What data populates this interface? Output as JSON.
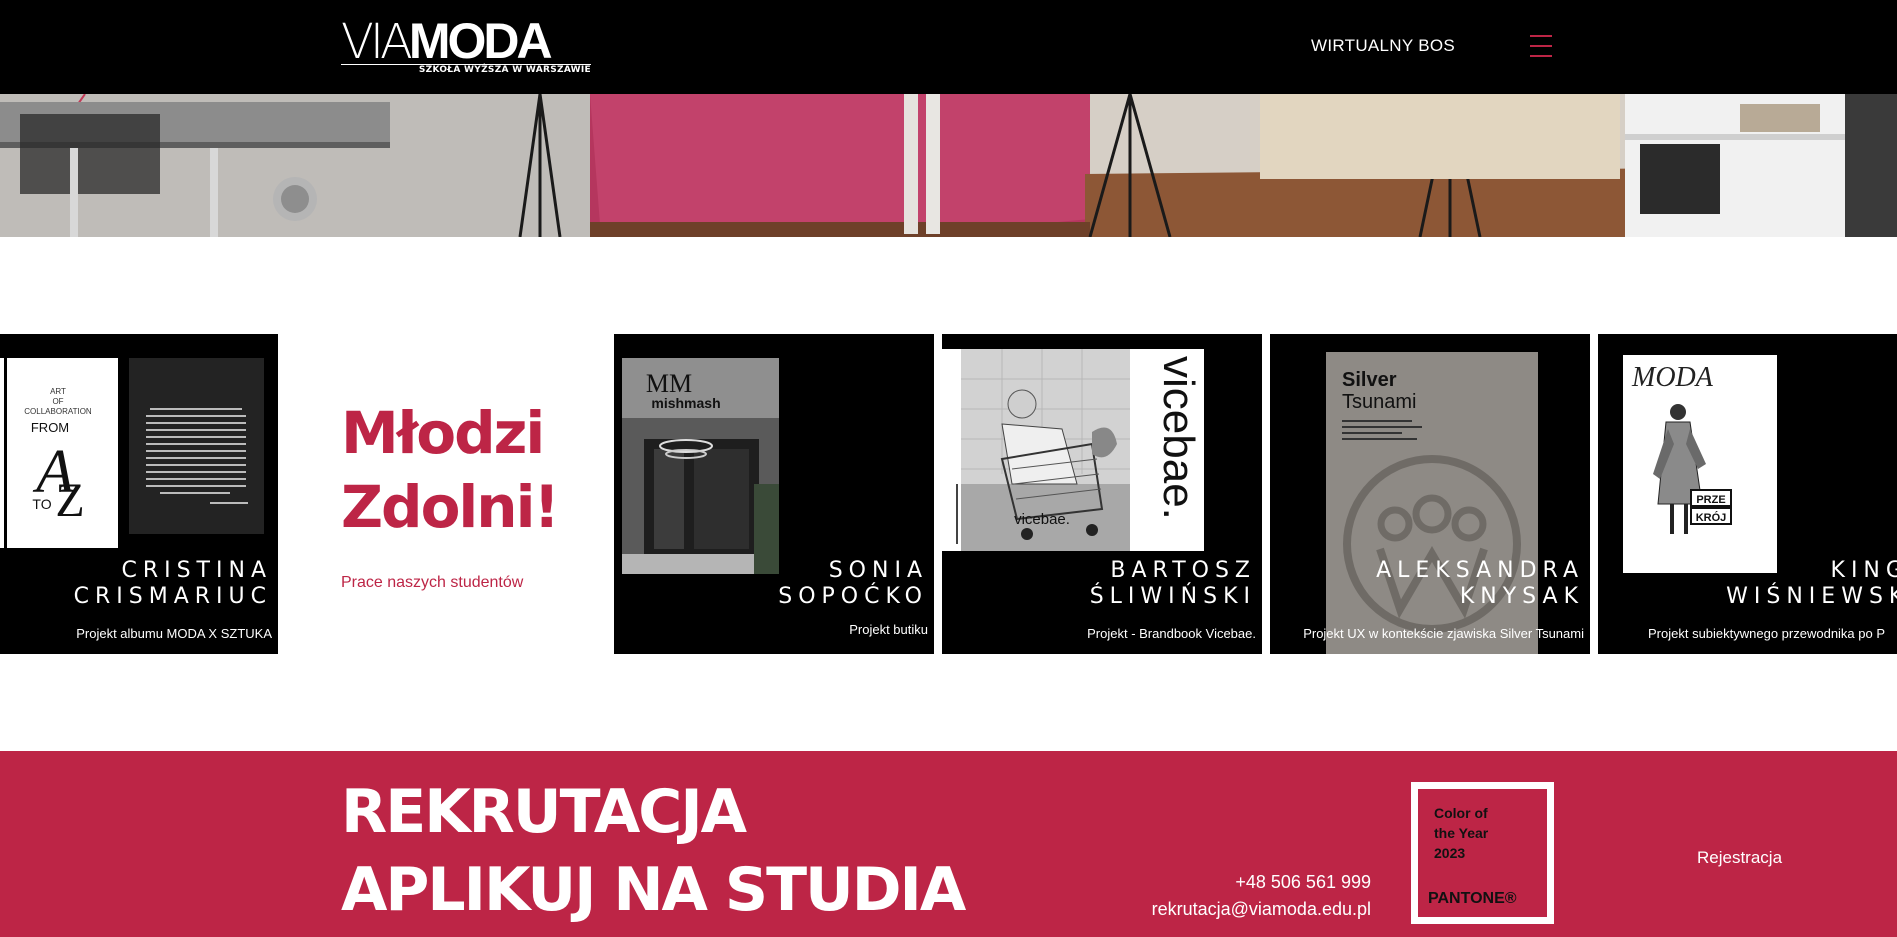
{
  "header": {
    "logo_via": "VIA",
    "logo_moda": "MODA",
    "logo_tagline": "SZKOŁA WYŻSZA W WARSZAWIE",
    "nav_link": "WIRTUALNY BOS",
    "menu_icon": "hamburger-menu-icon",
    "accent_color": "#bd2546"
  },
  "intro": {
    "title_line1": "Młodzi",
    "title_line2": "Zdolni!",
    "subtitle": "Prace naszych studentów"
  },
  "cards": [
    {
      "name_line1": "CRISTINA",
      "name_line2": "CRISMARIUC",
      "description": "Projekt albumu MODA X SZTUKA",
      "art_text": [
        "ART",
        "OF",
        "COLLABORATION",
        "FROM",
        "A",
        "TO",
        "Z"
      ]
    },
    {
      "name_line1": "SONIA",
      "name_line2": "SOPOĆKO",
      "description": "Projekt butiku",
      "art_text": [
        "MM",
        "mishmash"
      ]
    },
    {
      "name_line1": "BARTOSZ",
      "name_line2": "ŚLIWIŃSKI",
      "description": "Projekt - Brandbook Vicebae.",
      "art_text": [
        "vicebae.",
        "vicebae."
      ]
    },
    {
      "name_line1": "ALEKSANDRA",
      "name_line2": "KNYSAK",
      "description": "Projekt UX w kontekście zjawiska Silver Tsunami",
      "art_text": [
        "Silver",
        "Tsunami"
      ]
    },
    {
      "name_line1": "KINGA",
      "name_line2": "WIŚNIEWSKA",
      "description": "Projekt subiektywnego przewodnika po P",
      "art_text": [
        "MODA",
        "PRZE",
        "KRÓJ"
      ]
    }
  ],
  "recruitment": {
    "title_line1": "REKRUTACJA",
    "title_line2": "APLIKUJ NA STUDIA",
    "phone": "+48 506 561 999",
    "email": "rekrutacja@viamoda.edu.pl",
    "pantone_line1": "Color of",
    "pantone_line2": "the Year",
    "pantone_line3": "2023",
    "pantone_brand": "PANTONE®",
    "register_link": "Rejestracja",
    "band_color": "#bd2546"
  }
}
